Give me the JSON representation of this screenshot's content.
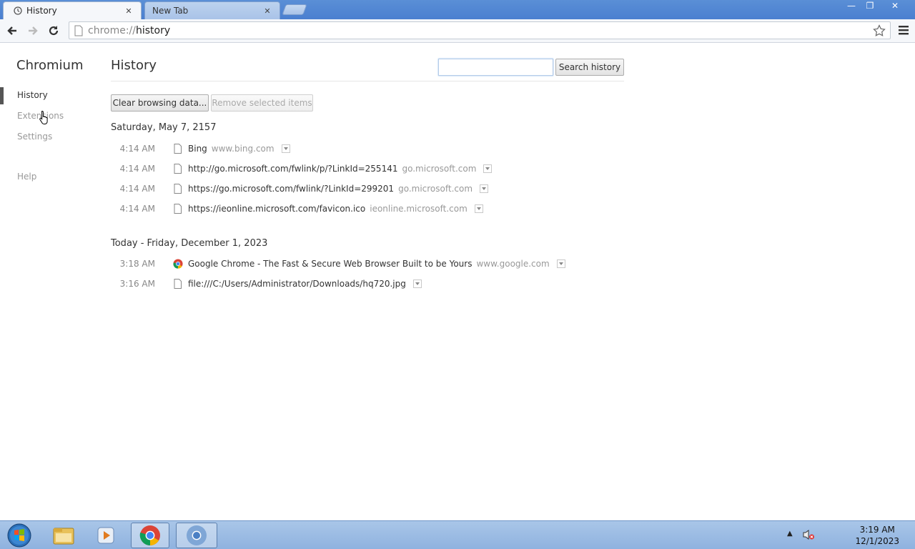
{
  "browser": {
    "tabs": [
      {
        "label": "History",
        "active": true
      },
      {
        "label": "New Tab",
        "active": false
      }
    ],
    "tab_close_glyph": "✕",
    "window_controls": {
      "minimize": "—",
      "maximize": "❐",
      "close": "✕"
    },
    "address": {
      "scheme": "chrome://",
      "host": "history"
    }
  },
  "sidebar": {
    "title": "Chromium",
    "items": [
      {
        "label": "History",
        "selected": true
      },
      {
        "label": "Extensions",
        "selected": false
      },
      {
        "label": "Settings",
        "selected": false
      },
      {
        "label": "Help",
        "selected": false
      }
    ]
  },
  "main": {
    "title": "History",
    "search": {
      "value": "",
      "placeholder": "",
      "button": "Search history"
    },
    "clear_button": "Clear browsing data...",
    "remove_button": "Remove selected items",
    "days": [
      {
        "header": "Saturday, May 7, 2157",
        "entries": [
          {
            "time": "4:14 AM",
            "title": "Bing",
            "domain": "www.bing.com",
            "icon": "page-icon"
          },
          {
            "time": "4:14 AM",
            "title": "http://go.microsoft.com/fwlink/p/?LinkId=255141",
            "domain": "go.microsoft.com",
            "icon": "page-icon"
          },
          {
            "time": "4:14 AM",
            "title": "https://go.microsoft.com/fwlink/?LinkId=299201",
            "domain": "go.microsoft.com",
            "icon": "page-icon"
          },
          {
            "time": "4:14 AM",
            "title": "https://ieonline.microsoft.com/favicon.ico",
            "domain": "ieonline.microsoft.com",
            "icon": "page-icon"
          }
        ]
      },
      {
        "header": "Today - Friday, December 1, 2023",
        "entries": [
          {
            "time": "3:18 AM",
            "title": "Google Chrome - The Fast & Secure Web Browser Built to be Yours",
            "domain": "www.google.com",
            "icon": "chrome-icon"
          },
          {
            "time": "3:16 AM",
            "title": "file:///C:/Users/Administrator/Downloads/hq720.jpg",
            "domain": "",
            "icon": "page-icon"
          }
        ]
      }
    ]
  },
  "taskbar": {
    "time": "3:19 AM",
    "date": "12/1/2023",
    "tray_arrow": "▲"
  },
  "colors": {
    "titlebar": "#4a7fd0",
    "taskbar": "#9dbde6",
    "muted_text": "#999999"
  }
}
